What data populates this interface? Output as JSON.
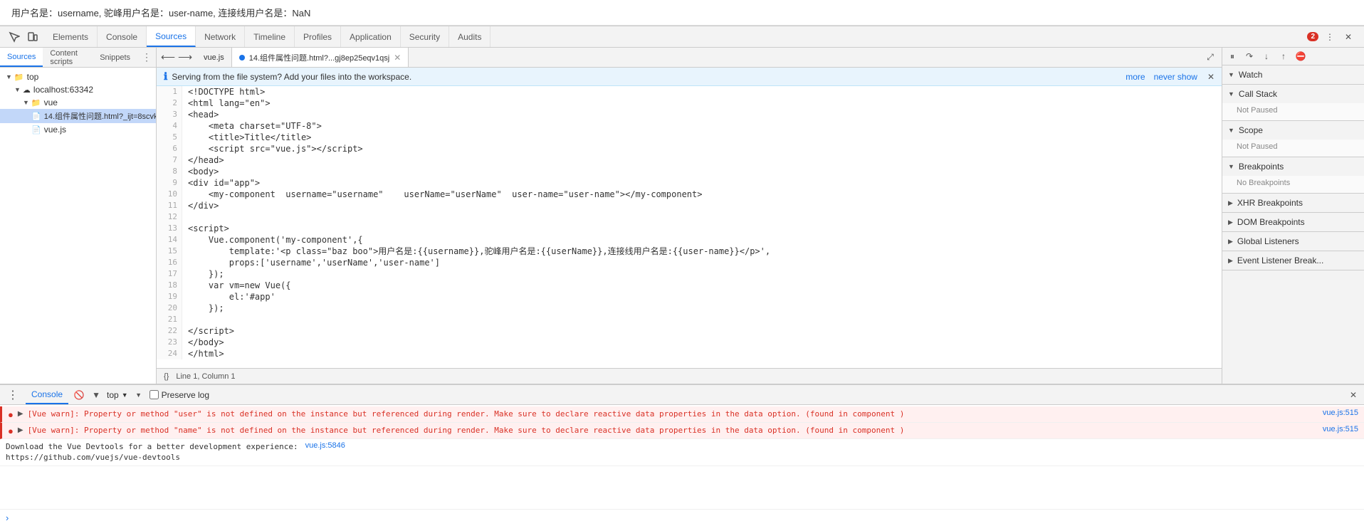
{
  "page": {
    "text": "用户名是：username, 驼峰用户名是：user-name, 连接线用户名是：NaN"
  },
  "devtools": {
    "tabs": [
      {
        "label": "Elements",
        "active": false
      },
      {
        "label": "Console",
        "active": false
      },
      {
        "label": "Sources",
        "active": true
      },
      {
        "label": "Network",
        "active": false
      },
      {
        "label": "Timeline",
        "active": false
      },
      {
        "label": "Profiles",
        "active": false
      },
      {
        "label": "Application",
        "active": false
      },
      {
        "label": "Security",
        "active": false
      },
      {
        "label": "Audits",
        "active": false
      }
    ],
    "error_count": "2",
    "sources_subtabs": [
      {
        "label": "Sources",
        "active": true
      },
      {
        "label": "Content scripts",
        "active": false
      },
      {
        "label": "Snippets",
        "active": false
      }
    ],
    "tree": {
      "top_label": "top",
      "localhost_label": "localhost:63342",
      "vue_folder": "vue",
      "file1": "14.组件属性问题.html?_ijt=8scvkt0g...",
      "file2": "vue.js"
    },
    "code_tabs": [
      {
        "label": "vue.js",
        "active": false
      },
      {
        "label": "14.组件属性问题.html?...gj8ep25eqv1qsj",
        "active": true,
        "closable": true
      }
    ],
    "info_bar": {
      "text": "Serving from the file system? Add your files into the workspace.",
      "link_more": "more",
      "link_never": "never show"
    },
    "code_lines": [
      {
        "num": "1",
        "html": "&lt;!DOCTYPE html&gt;"
      },
      {
        "num": "2",
        "html": "&lt;html lang=\"en\"&gt;"
      },
      {
        "num": "3",
        "html": "&lt;head&gt;"
      },
      {
        "num": "4",
        "html": "    &lt;meta charset=\"UTF-8\"&gt;"
      },
      {
        "num": "5",
        "html": "    &lt;title&gt;Title&lt;/title&gt;"
      },
      {
        "num": "6",
        "html": "    &lt;script src=\"vue.js\"&gt;&lt;/script&gt;"
      },
      {
        "num": "7",
        "html": "&lt;/head&gt;"
      },
      {
        "num": "8",
        "html": "&lt;body&gt;"
      },
      {
        "num": "9",
        "html": "&lt;div id=\"app\"&gt;"
      },
      {
        "num": "10",
        "html": "    &lt;my-component  username=\"username\"    userName=\"userName\"  user-name=\"user-name\"&gt;&lt;/my-component&gt;"
      },
      {
        "num": "11",
        "html": "&lt;/div&gt;"
      },
      {
        "num": "12",
        "html": ""
      },
      {
        "num": "13",
        "html": "&lt;script&gt;"
      },
      {
        "num": "14",
        "html": "    Vue.component('my-component',{"
      },
      {
        "num": "15",
        "html": "        template:'&lt;p class=\"baz boo\"&gt;用户名是:{{username}},驼峰用户名是:{{userName}},连接线用户名是:{{user-name}}&lt;/p&gt;',"
      },
      {
        "num": "16",
        "html": "        props:['username','userName','user-name']"
      },
      {
        "num": "17",
        "html": "    });"
      },
      {
        "num": "18",
        "html": "    var vm=new Vue({"
      },
      {
        "num": "19",
        "html": "        el:'#app'"
      },
      {
        "num": "20",
        "html": "    });"
      },
      {
        "num": "21",
        "html": ""
      },
      {
        "num": "22",
        "html": "&lt;/script&gt;"
      },
      {
        "num": "23",
        "html": "&lt;/body&gt;"
      },
      {
        "num": "24",
        "html": "&lt;/html&gt;"
      }
    ],
    "status_bar": {
      "braces": "{}",
      "position": "Line 1, Column 1"
    },
    "right_panel": {
      "sections": [
        {
          "label": "Watch",
          "expanded": true,
          "content": ""
        },
        {
          "label": "Call Stack",
          "expanded": true,
          "content": "Not Paused"
        },
        {
          "label": "Scope",
          "expanded": true,
          "content": "Not Paused"
        },
        {
          "label": "Breakpoints",
          "expanded": true,
          "content": "No Breakpoints"
        },
        {
          "label": "XHR Breakpoints",
          "expanded": false,
          "content": ""
        },
        {
          "label": "DOM Breakpoints",
          "expanded": false,
          "content": ""
        },
        {
          "label": "Global Listeners",
          "expanded": false,
          "content": ""
        },
        {
          "label": "Event Listener Break...",
          "expanded": false,
          "content": ""
        }
      ]
    },
    "console": {
      "tab": "Console",
      "top_label": "top",
      "preserve_log": "Preserve log",
      "messages": [
        {
          "type": "error",
          "text": "[Vue warn]: Property or method \"user\" is not defined on the instance but referenced during render. Make sure to declare reactive data properties in the data option. (found in component <my-component>)",
          "link": "vue.js:515"
        },
        {
          "type": "error",
          "text": "[Vue warn]: Property or method \"name\" is not defined on the instance but referenced during render. Make sure to declare reactive data properties in the data option. (found in component <my-component>)",
          "link": "vue.js:515"
        },
        {
          "type": "info",
          "text": "Download the Vue Devtools for a better development experience:\nhttps://github.com/vuejs/vue-devtools",
          "link": "vue.js:5846"
        }
      ]
    }
  }
}
